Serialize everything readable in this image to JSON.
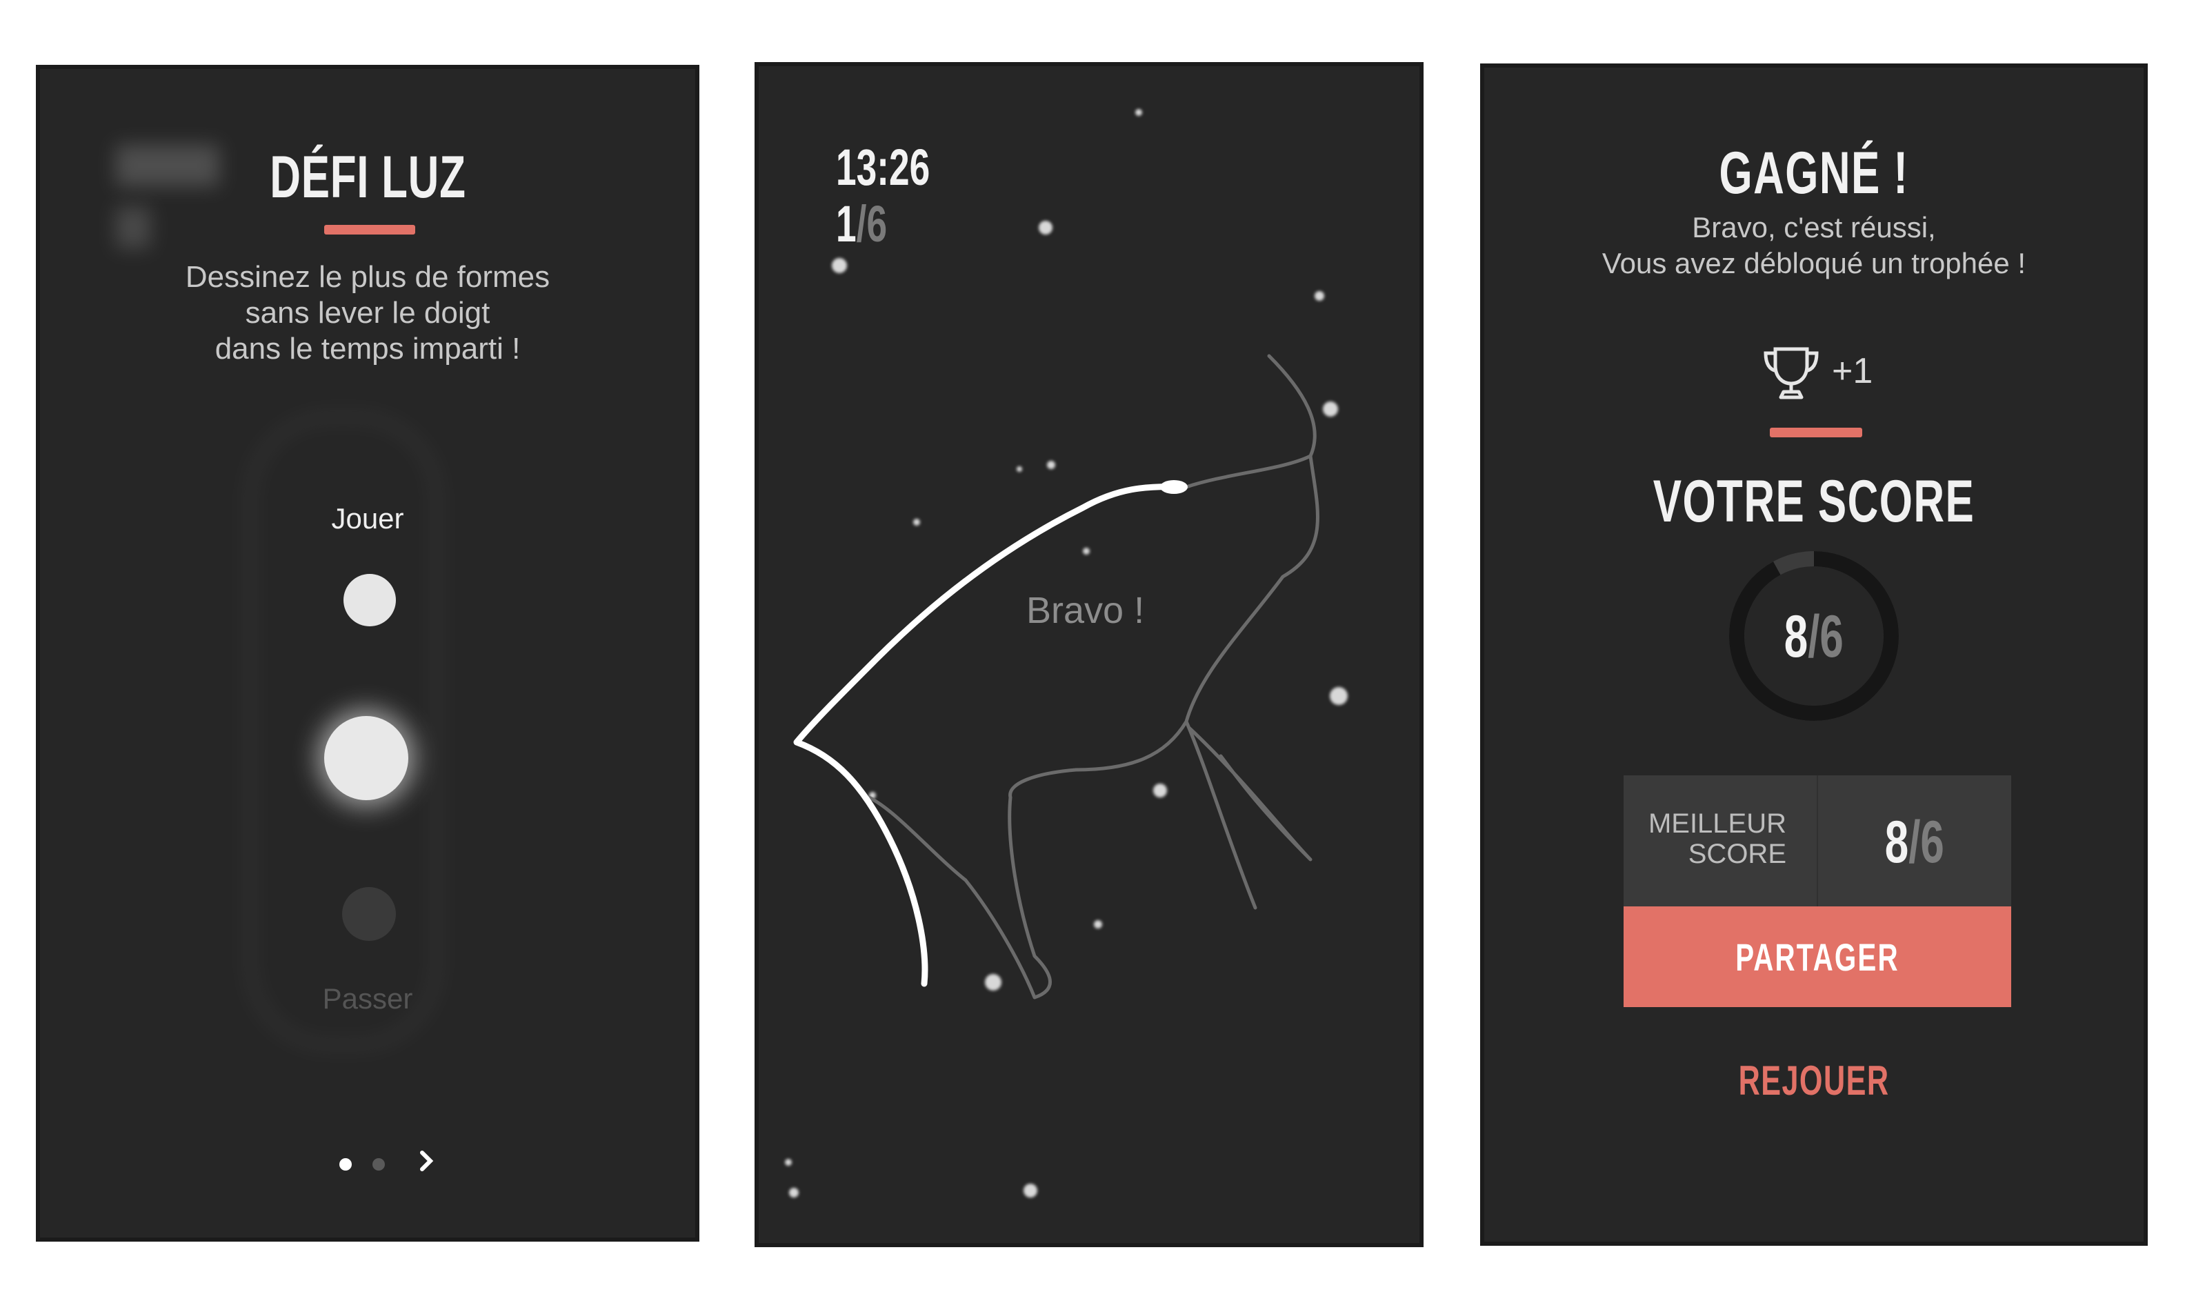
{
  "colors": {
    "panel_bg": "#262626",
    "accent": "#e27267",
    "text_light": "#f1f1f1",
    "text_muted": "#c8c8c8",
    "text_dim": "#555555"
  },
  "screen_intro": {
    "title": "DÉFI LUZ",
    "description": [
      "Dessinez le plus de formes",
      "sans lever le doigt",
      "dans le temps imparti !"
    ],
    "play_label": "Jouer",
    "skip_label": "Passer",
    "pager": {
      "pages": 2,
      "active": 1,
      "next_icon": "chevron-right-icon"
    }
  },
  "screen_game": {
    "timer": "13:26",
    "progress_current": "1",
    "progress_separator": "/",
    "progress_total": "6",
    "feedback": "Bravo !"
  },
  "screen_result": {
    "title": "GAGNÉ !",
    "message": [
      "Bravo, c'est réussi,",
      "Vous avez débloqué un trophée !"
    ],
    "trophy_icon": "trophy-icon",
    "trophy_count": "+1",
    "score_title": "VOTRE SCORE",
    "score_value": "8",
    "score_separator": "/",
    "score_total": "6",
    "score_ring_fraction": 0.92,
    "best_score_label": [
      "MEILLEUR",
      "SCORE"
    ],
    "best_score_value": "8",
    "best_score_separator": "/",
    "best_score_total": "6",
    "share_label": "PARTAGER",
    "replay_label": "REJOUER"
  }
}
